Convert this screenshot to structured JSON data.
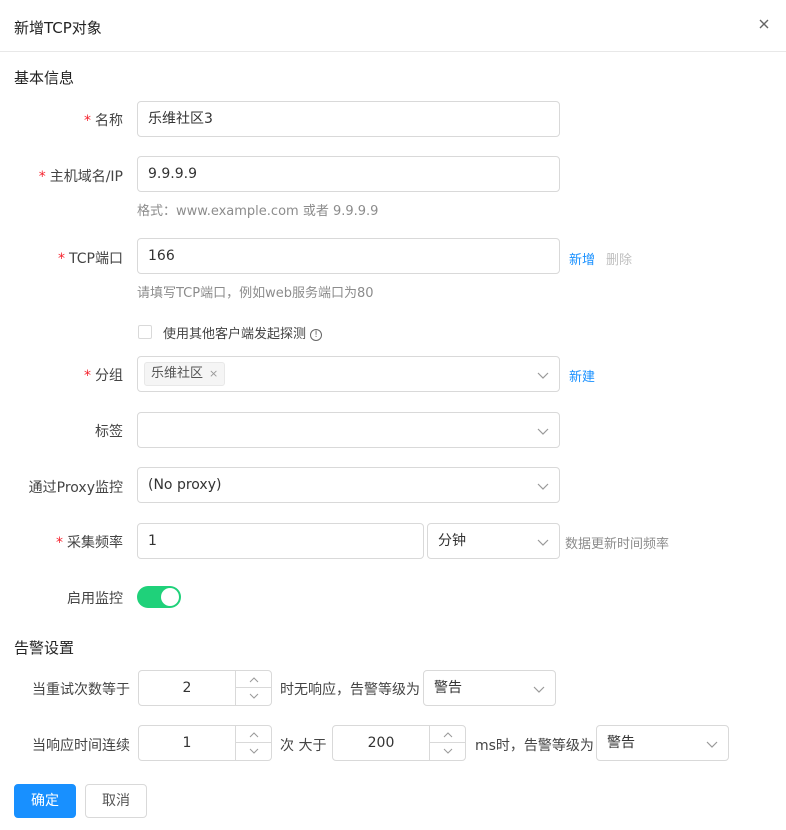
{
  "dialog": {
    "title": "新增TCP对象",
    "close_icon": "close-icon"
  },
  "basic": {
    "section_title": "基本信息",
    "name": {
      "required": "*",
      "label": "名称",
      "value": "乐维社区3"
    },
    "host": {
      "required": "*",
      "label": "主机域名/IP",
      "value": "9.9.9.9",
      "help": "格式：www.example.com 或者 9.9.9.9"
    },
    "port": {
      "required": "*",
      "label": "TCP端口",
      "value": "166",
      "add_label": "新增",
      "delete_label": "删除",
      "help": "请填写TCP端口，例如web服务端口为80"
    },
    "other_client": {
      "label": "使用其他客户端发起探测",
      "checked": false,
      "info_icon": "info-icon",
      "info_glyph": "!"
    },
    "group": {
      "required": "*",
      "label": "分组",
      "tags": [
        "乐维社区"
      ],
      "tag_close": "×",
      "new_label": "新建"
    },
    "tags": {
      "label": "标签",
      "value": ""
    },
    "proxy": {
      "label": "通过Proxy监控",
      "value": "(No proxy)"
    },
    "frequency": {
      "required": "*",
      "label": "采集频率",
      "value": "1",
      "unit": "分钟",
      "help": "数据更新时间频率"
    },
    "enable": {
      "label": "启用监控",
      "on": true
    }
  },
  "alerts": {
    "section_title": "告警设置",
    "retry": {
      "label": "当重试次数等于",
      "value": "2",
      "middle_text": "时无响应，告警等级为",
      "level": "警告"
    },
    "response": {
      "label": "当响应时间连续",
      "count": "1",
      "text_count": "次 大于",
      "ms": "200",
      "text_ms": "ms时，告警等级为",
      "level": "警告"
    }
  },
  "footer": {
    "confirm_label": "确定",
    "cancel_label": "取消"
  },
  "colors": {
    "primary": "#1890ff",
    "required": "#f5222d",
    "switch_on": "#1fd17a"
  }
}
